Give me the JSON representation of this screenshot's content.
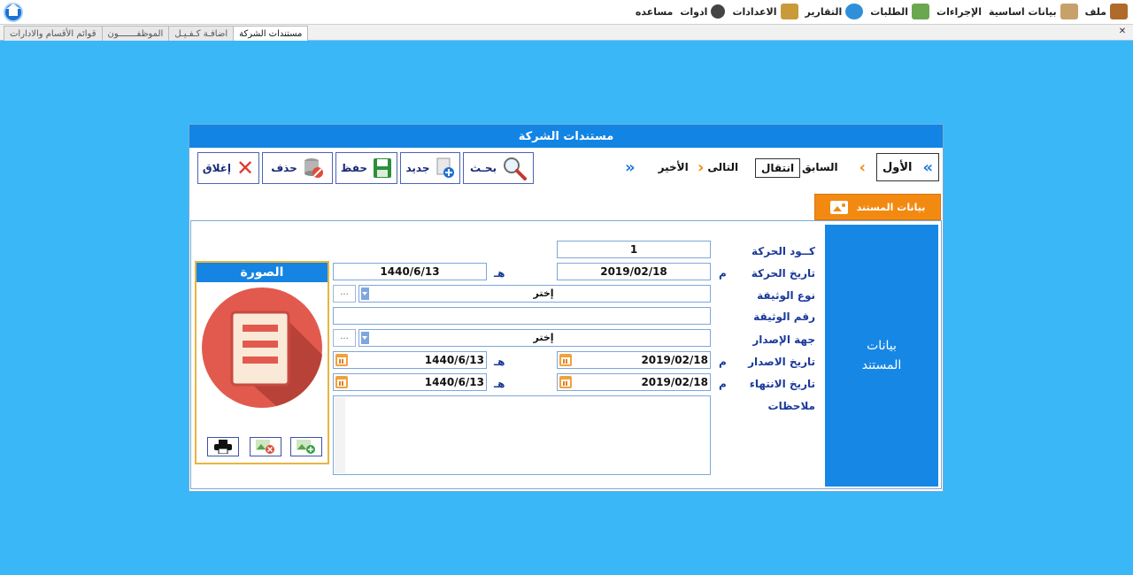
{
  "menu": {
    "items": [
      {
        "label": "ملف",
        "icon": "box-icon",
        "color": "#b06a2a"
      },
      {
        "label": "بيانات اساسية",
        "icon": "boxes-icon",
        "color": "#c8a06a"
      },
      {
        "label": "الإجراءات",
        "icon": "",
        "color": ""
      },
      {
        "label": "الطلبات",
        "icon": "money-icon",
        "color": "#6aa84f"
      },
      {
        "label": "التقارير",
        "icon": "tools-icon",
        "color": "#2f8fd8"
      },
      {
        "label": "الاعدادات",
        "icon": "folder-icon",
        "color": "#c89a3a"
      },
      {
        "label": "ادوات",
        "icon": "gears-icon",
        "color": "#444444"
      },
      {
        "label": "مساعده",
        "icon": "",
        "color": ""
      }
    ]
  },
  "tabs": [
    "مستندات الشركة",
    "اضافـة كـفـيـل",
    "الموظفـــــــون",
    "قوائم الأقسام والادارات"
  ],
  "panel": {
    "title": "مستندات الشركة",
    "toolbar": {
      "close": "إغلاق",
      "delete": "حذف",
      "save": "حفظ",
      "new": "جديد",
      "search": "بحـث"
    },
    "nav": {
      "first": "الأول",
      "prev": "السابق",
      "goto": "انتقال",
      "next": "التالى",
      "last": "الأخير"
    },
    "section_tab": "بيانات المستند",
    "side_label_1": "بيانات",
    "side_label_2": "المستند",
    "photo": {
      "title": "الصورة",
      "circle_color": "#e25a4e",
      "shadow_color": "#b94238"
    },
    "labels": {
      "code": "كــود الحركة",
      "move_date": "تاريخ الحركة",
      "doc_type": "نوع الوثيقة",
      "doc_no": "رقم الوثيقة",
      "issuer": "جهة الإصدار",
      "issue_date": "تاريخ الاصدار",
      "expiry_date": "تاريخ الانتهاء",
      "notes": "ملاحظات"
    },
    "unit_greg": "م",
    "unit_hijri": "هـ",
    "values": {
      "code": "1",
      "move_date_greg": "2019/02/18",
      "move_date_hijri": "1440/6/13",
      "doc_type": "إختر",
      "doc_no": "",
      "issuer": "إختر",
      "issue_date_greg": "2019/02/18",
      "issue_date_hijri": "1440/6/13",
      "expiry_date_greg": "2019/02/18",
      "expiry_date_hijri": "1440/6/13",
      "notes": ""
    },
    "dots": "..."
  },
  "colors": {
    "background": "#3ab7f7",
    "header_blue": "#1284e3",
    "accent_orange": "#f28a12",
    "label_blue": "#1b3a9b"
  }
}
